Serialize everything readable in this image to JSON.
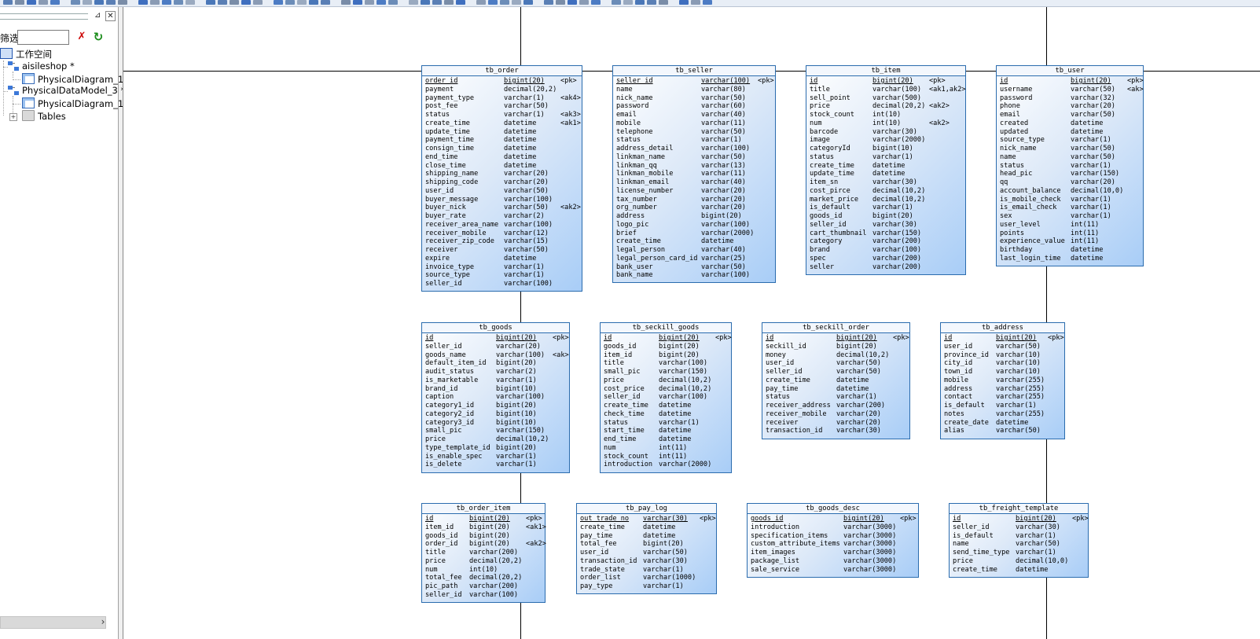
{
  "browser": {
    "filter_label": "筛选",
    "filter_value": "",
    "tree": [
      {
        "label": "工作空间",
        "icon": "workspace-icon"
      },
      {
        "label": "aisileshop *",
        "icon": "model-icon"
      },
      {
        "label": "PhysicalDiagram_1",
        "icon": "diagram-icon"
      },
      {
        "label": "PhysicalDataModel_3 *",
        "icon": "model-icon"
      },
      {
        "label": "PhysicalDiagram_1",
        "icon": "diagram-icon"
      },
      {
        "label": "Tables",
        "icon": "folder-icon"
      }
    ]
  },
  "tables": [
    {
      "name": "tb_order",
      "columns": [
        [
          "order_id",
          "bigint(20)",
          "<pk>"
        ],
        [
          "payment",
          "decimal(20,2)",
          ""
        ],
        [
          "payment_type",
          "varchar(1)",
          "<ak4>"
        ],
        [
          "post_fee",
          "varchar(50)",
          ""
        ],
        [
          "status",
          "varchar(1)",
          "<ak3>"
        ],
        [
          "create_time",
          "datetime",
          "<ak1>"
        ],
        [
          "update_time",
          "datetime",
          ""
        ],
        [
          "payment_time",
          "datetime",
          ""
        ],
        [
          "consign_time",
          "datetime",
          ""
        ],
        [
          "end_time",
          "datetime",
          ""
        ],
        [
          "close_time",
          "datetime",
          ""
        ],
        [
          "shipping_name",
          "varchar(20)",
          ""
        ],
        [
          "shipping_code",
          "varchar(20)",
          ""
        ],
        [
          "user_id",
          "varchar(50)",
          ""
        ],
        [
          "buyer_message",
          "varchar(100)",
          ""
        ],
        [
          "buyer_nick",
          "varchar(50)",
          "<ak2>"
        ],
        [
          "buyer_rate",
          "varchar(2)",
          ""
        ],
        [
          "receiver_area_name",
          "varchar(100)",
          ""
        ],
        [
          "receiver_mobile",
          "varchar(12)",
          ""
        ],
        [
          "receiver_zip_code",
          "varchar(15)",
          ""
        ],
        [
          "receiver",
          "varchar(50)",
          ""
        ],
        [
          "expire",
          "datetime",
          ""
        ],
        [
          "invoice_type",
          "varchar(1)",
          ""
        ],
        [
          "source_type",
          "varchar(1)",
          ""
        ],
        [
          "seller_id",
          "varchar(100)",
          ""
        ]
      ]
    },
    {
      "name": "tb_seller",
      "columns": [
        [
          "seller_id",
          "varchar(100)",
          "<pk>"
        ],
        [
          "name",
          "varchar(80)",
          ""
        ],
        [
          "nick_name",
          "varchar(50)",
          ""
        ],
        [
          "password",
          "varchar(60)",
          ""
        ],
        [
          "email",
          "varchar(40)",
          ""
        ],
        [
          "mobile",
          "varchar(11)",
          ""
        ],
        [
          "telephone",
          "varchar(50)",
          ""
        ],
        [
          "status",
          "varchar(1)",
          ""
        ],
        [
          "address_detail",
          "varchar(100)",
          ""
        ],
        [
          "linkman_name",
          "varchar(50)",
          ""
        ],
        [
          "linkman_qq",
          "varchar(13)",
          ""
        ],
        [
          "linkman_mobile",
          "varchar(11)",
          ""
        ],
        [
          "linkman_email",
          "varchar(40)",
          ""
        ],
        [
          "license_number",
          "varchar(20)",
          ""
        ],
        [
          "tax_number",
          "varchar(20)",
          ""
        ],
        [
          "org_number",
          "varchar(20)",
          ""
        ],
        [
          "address",
          "bigint(20)",
          ""
        ],
        [
          "logo_pic",
          "varchar(100)",
          ""
        ],
        [
          "brief",
          "varchar(2000)",
          ""
        ],
        [
          "create_time",
          "datetime",
          ""
        ],
        [
          "legal_person",
          "varchar(40)",
          ""
        ],
        [
          "legal_person_card_id",
          "varchar(25)",
          ""
        ],
        [
          "bank_user",
          "varchar(50)",
          ""
        ],
        [
          "bank_name",
          "varchar(100)",
          ""
        ]
      ]
    },
    {
      "name": "tb_item",
      "columns": [
        [
          "id",
          "bigint(20)",
          "<pk>"
        ],
        [
          "title",
          "varchar(100)",
          "<ak1,ak2>"
        ],
        [
          "sell_point",
          "varchar(500)",
          ""
        ],
        [
          "price",
          "decimal(20,2)",
          "<ak2>"
        ],
        [
          "stock_count",
          "int(10)",
          ""
        ],
        [
          "num",
          "int(10)",
          "<ak2>"
        ],
        [
          "barcode",
          "varchar(30)",
          ""
        ],
        [
          "image",
          "varchar(2000)",
          ""
        ],
        [
          "categoryId",
          "bigint(10)",
          ""
        ],
        [
          "status",
          "varchar(1)",
          ""
        ],
        [
          "create_time",
          "datetime",
          ""
        ],
        [
          "update_time",
          "datetime",
          ""
        ],
        [
          "item_sn",
          "varchar(30)",
          ""
        ],
        [
          "cost_pirce",
          "decimal(10,2)",
          ""
        ],
        [
          "market_price",
          "decimal(10,2)",
          ""
        ],
        [
          "is_default",
          "varchar(1)",
          ""
        ],
        [
          "goods_id",
          "bigint(20)",
          ""
        ],
        [
          "seller_id",
          "varchar(30)",
          ""
        ],
        [
          "cart_thumbnail",
          "varchar(150)",
          ""
        ],
        [
          "category",
          "varchar(200)",
          ""
        ],
        [
          "brand",
          "varchar(100)",
          ""
        ],
        [
          "spec",
          "varchar(200)",
          ""
        ],
        [
          "seller",
          "varchar(200)",
          ""
        ]
      ]
    },
    {
      "name": "tb_user",
      "columns": [
        [
          "id",
          "bigint(20)",
          "<pk>"
        ],
        [
          "username",
          "varchar(50)",
          "<ak>"
        ],
        [
          "password",
          "varchar(32)",
          ""
        ],
        [
          "phone",
          "varchar(20)",
          ""
        ],
        [
          "email",
          "varchar(50)",
          ""
        ],
        [
          "created",
          "datetime",
          ""
        ],
        [
          "updated",
          "datetime",
          ""
        ],
        [
          "source_type",
          "varchar(1)",
          ""
        ],
        [
          "nick_name",
          "varchar(50)",
          ""
        ],
        [
          "name",
          "varchar(50)",
          ""
        ],
        [
          "status",
          "varchar(1)",
          ""
        ],
        [
          "head_pic",
          "varchar(150)",
          ""
        ],
        [
          "qq",
          "varchar(20)",
          ""
        ],
        [
          "account_balance",
          "decimal(10,0)",
          ""
        ],
        [
          "is_mobile_check",
          "varchar(1)",
          ""
        ],
        [
          "is_email_check",
          "varchar(1)",
          ""
        ],
        [
          "sex",
          "varchar(1)",
          ""
        ],
        [
          "user_level",
          "int(11)",
          ""
        ],
        [
          "points",
          "int(11)",
          ""
        ],
        [
          "experience_value",
          "int(11)",
          ""
        ],
        [
          "birthday",
          "datetime",
          ""
        ],
        [
          "last_login_time",
          "datetime",
          ""
        ]
      ]
    },
    {
      "name": "tb_goods",
      "columns": [
        [
          "id",
          "bigint(20)",
          "<pk>"
        ],
        [
          "seller_id",
          "varchar(20)",
          ""
        ],
        [
          "goods_name",
          "varchar(100)",
          "<ak>"
        ],
        [
          "default_item_id",
          "bigint(20)",
          ""
        ],
        [
          "audit_status",
          "varchar(2)",
          ""
        ],
        [
          "is_marketable",
          "varchar(1)",
          ""
        ],
        [
          "brand_id",
          "bigint(10)",
          ""
        ],
        [
          "caption",
          "varchar(100)",
          ""
        ],
        [
          "category1_id",
          "bigint(20)",
          ""
        ],
        [
          "category2_id",
          "bigint(10)",
          ""
        ],
        [
          "category3_id",
          "bigint(10)",
          ""
        ],
        [
          "small_pic",
          "varchar(150)",
          ""
        ],
        [
          "price",
          "decimal(10,2)",
          ""
        ],
        [
          "type_template_id",
          "bigint(20)",
          ""
        ],
        [
          "is_enable_spec",
          "varchar(1)",
          ""
        ],
        [
          "is_delete",
          "varchar(1)",
          ""
        ]
      ]
    },
    {
      "name": "tb_seckill_goods",
      "columns": [
        [
          "id",
          "bigint(20)",
          "<pk>"
        ],
        [
          "goods_id",
          "bigint(20)",
          ""
        ],
        [
          "item_id",
          "bigint(20)",
          ""
        ],
        [
          "title",
          "varchar(100)",
          ""
        ],
        [
          "small_pic",
          "varchar(150)",
          ""
        ],
        [
          "price",
          "decimal(10,2)",
          ""
        ],
        [
          "cost_price",
          "decimal(10,2)",
          ""
        ],
        [
          "seller_id",
          "varchar(100)",
          ""
        ],
        [
          "create_time",
          "datetime",
          ""
        ],
        [
          "check_time",
          "datetime",
          ""
        ],
        [
          "status",
          "varchar(1)",
          ""
        ],
        [
          "start_time",
          "datetime",
          ""
        ],
        [
          "end_time",
          "datetime",
          ""
        ],
        [
          "num",
          "int(11)",
          ""
        ],
        [
          "stock_count",
          "int(11)",
          ""
        ],
        [
          "introduction",
          "varchar(2000)",
          ""
        ]
      ]
    },
    {
      "name": "tb_seckill_order",
      "columns": [
        [
          "id",
          "bigint(20)",
          "<pk>"
        ],
        [
          "seckill_id",
          "bigint(20)",
          ""
        ],
        [
          "money",
          "decimal(10,2)",
          ""
        ],
        [
          "user_id",
          "varchar(50)",
          ""
        ],
        [
          "seller_id",
          "varchar(50)",
          ""
        ],
        [
          "create_time",
          "datetime",
          ""
        ],
        [
          "pay_time",
          "datetime",
          ""
        ],
        [
          "status",
          "varchar(1)",
          ""
        ],
        [
          "receiver_address",
          "varchar(200)",
          ""
        ],
        [
          "receiver_mobile",
          "varchar(20)",
          ""
        ],
        [
          "receiver",
          "varchar(20)",
          ""
        ],
        [
          "transaction_id",
          "varchar(30)",
          ""
        ]
      ]
    },
    {
      "name": "tb_address",
      "columns": [
        [
          "id",
          "bigint(20)",
          "<pk>"
        ],
        [
          "user_id",
          "varchar(50)",
          ""
        ],
        [
          "province_id",
          "varchar(10)",
          ""
        ],
        [
          "city_id",
          "varchar(10)",
          ""
        ],
        [
          "town_id",
          "varchar(10)",
          ""
        ],
        [
          "mobile",
          "varchar(255)",
          ""
        ],
        [
          "address",
          "varchar(255)",
          ""
        ],
        [
          "contact",
          "varchar(255)",
          ""
        ],
        [
          "is_default",
          "varchar(1)",
          ""
        ],
        [
          "notes",
          "varchar(255)",
          ""
        ],
        [
          "create_date",
          "datetime",
          ""
        ],
        [
          "alias",
          "varchar(50)",
          ""
        ]
      ]
    },
    {
      "name": "tb_order_item",
      "columns": [
        [
          "id",
          "bigint(20)",
          "<pk>"
        ],
        [
          "item_id",
          "bigint(20)",
          "<ak1>"
        ],
        [
          "goods_id",
          "bigint(20)",
          ""
        ],
        [
          "order_id",
          "bigint(20)",
          "<ak2>"
        ],
        [
          "title",
          "varchar(200)",
          ""
        ],
        [
          "price",
          "decimal(20,2)",
          ""
        ],
        [
          "num",
          "int(10)",
          ""
        ],
        [
          "total_fee",
          "decimal(20,2)",
          ""
        ],
        [
          "pic_path",
          "varchar(200)",
          ""
        ],
        [
          "seller_id",
          "varchar(100)",
          ""
        ]
      ]
    },
    {
      "name": "tb_pay_log",
      "columns": [
        [
          "out_trade_no",
          "varchar(30)",
          "<pk>"
        ],
        [
          "create_time",
          "datetime",
          ""
        ],
        [
          "pay_time",
          "datetime",
          ""
        ],
        [
          "total_fee",
          "bigint(20)",
          ""
        ],
        [
          "user_id",
          "varchar(50)",
          ""
        ],
        [
          "transaction_id",
          "varchar(30)",
          ""
        ],
        [
          "trade_state",
          "varchar(1)",
          ""
        ],
        [
          "order_list",
          "varchar(1000)",
          ""
        ],
        [
          "pay_type",
          "varchar(1)",
          ""
        ]
      ]
    },
    {
      "name": "tb_goods_desc",
      "columns": [
        [
          "goods_id",
          "bigint(20)",
          "<pk>"
        ],
        [
          "introduction",
          "varchar(3000)",
          ""
        ],
        [
          "specification_items",
          "varchar(3000)",
          ""
        ],
        [
          "custom_attribute_items",
          "varchar(3000)",
          ""
        ],
        [
          "item_images",
          "varchar(3000)",
          ""
        ],
        [
          "package_list",
          "varchar(3000)",
          ""
        ],
        [
          "sale_service",
          "varchar(3000)",
          ""
        ]
      ]
    },
    {
      "name": "tb_freight_template",
      "columns": [
        [
          "id",
          "bigint(20)",
          "<pk>"
        ],
        [
          "seller_id",
          "varchar(30)",
          ""
        ],
        [
          "is_default",
          "varchar(1)",
          ""
        ],
        [
          "name",
          "varchar(50)",
          ""
        ],
        [
          "send_time_type",
          "varchar(1)",
          ""
        ],
        [
          "price",
          "decimal(10,0)",
          ""
        ],
        [
          "create_time",
          "datetime",
          ""
        ]
      ]
    }
  ]
}
